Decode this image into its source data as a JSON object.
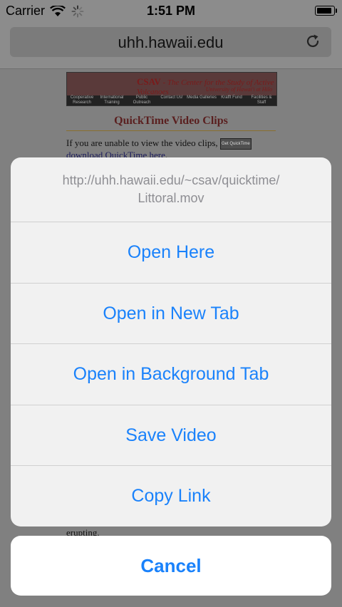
{
  "status_bar": {
    "carrier": "Carrier",
    "time": "1:51 PM"
  },
  "url_bar": {
    "domain": "uhh.hawaii.edu"
  },
  "page": {
    "banner": {
      "title_strong": "CSAV",
      "title_rest": " - The Center for the Study of Active Volcanoes",
      "subtitle": "University of Hawai'i at Hilo",
      "nav": [
        "Cooperative Research",
        "International Training",
        "Public Outreach",
        "Contact Us!",
        "Media Galleries",
        "Krafft Fund",
        "Facilities & Staff"
      ]
    },
    "heading": "QuickTime Video Clips",
    "para_text": "If you are unable to view the video clips,",
    "para_link": "download QuickTime here",
    "qt_badge": "Get QuickTime",
    "foot_text": "erupting."
  },
  "action_sheet": {
    "url": "http://uhh.hawaii.edu/~csav/quicktime/",
    "url_file": "Littoral.mov",
    "items": [
      "Open Here",
      "Open in New Tab",
      "Open in Background Tab",
      "Save Video",
      "Copy Link"
    ],
    "cancel": "Cancel"
  }
}
